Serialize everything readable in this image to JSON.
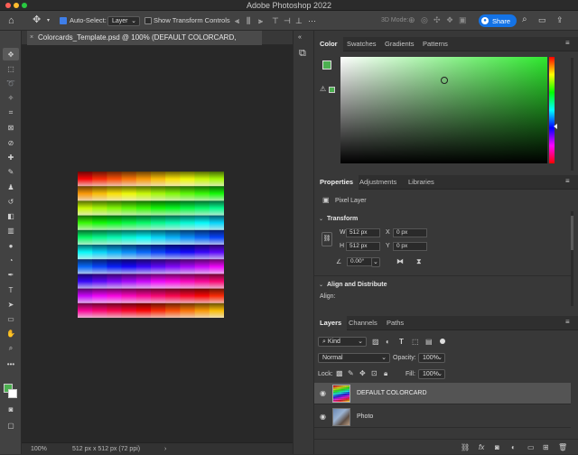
{
  "app": {
    "title": "Adobe Photoshop 2022"
  },
  "options": {
    "auto_select_label": "Auto-Select:",
    "auto_select_value": "Layer",
    "transform_label": "Show Transform Controls",
    "mode_label": "3D Mode:",
    "share_label": "Share",
    "more": "•••"
  },
  "document": {
    "tab_title": "Colorcards_Template.psd @ 100% (DEFAULT COLORCARD, RGB/8) *",
    "zoom": "100%",
    "info": "512 px x 512 px (72 ppi)",
    "grid_rows": 10,
    "grid_cols": 10
  },
  "color_panel": {
    "tabs": [
      "Color",
      "Swatches",
      "Gradients",
      "Patterns"
    ],
    "foreground": "#4caf50",
    "hue_color": "#2ee82e",
    "picker_x": 0.5,
    "picker_y": 0.22
  },
  "properties_panel": {
    "tabs": [
      "Properties",
      "Adjustments",
      "Libraries"
    ],
    "kind": "Pixel Layer",
    "transform_title": "Transform",
    "w_label": "W",
    "w_value": "512 px",
    "h_label": "H",
    "h_value": "512 px",
    "x_label": "X",
    "x_value": "0 px",
    "y_label": "Y",
    "y_value": "0 px",
    "angle_value": "0.00°",
    "align_title": "Align and Distribute",
    "align_label": "Align:"
  },
  "layers_panel": {
    "tabs": [
      "Layers",
      "Channels",
      "Paths"
    ],
    "filter_label": "Kind",
    "blend_mode": "Normal",
    "opacity_label": "Opacity:",
    "opacity_value": "100%",
    "lock_label": "Lock:",
    "fill_label": "Fill:",
    "fill_value": "100%",
    "layers": [
      {
        "name": "DEFAULT COLORCARD",
        "selected": true
      },
      {
        "name": "Photo",
        "selected": false
      }
    ]
  }
}
